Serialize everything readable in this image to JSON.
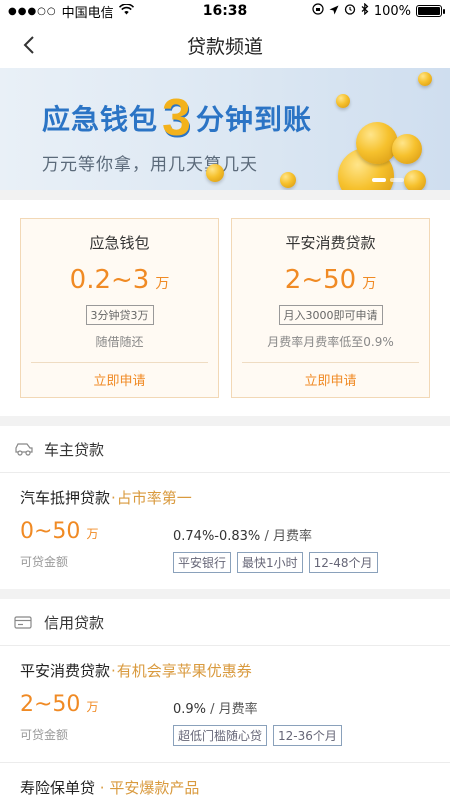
{
  "status": {
    "carrier": "中国电信",
    "time": "16:38",
    "battery": "100%"
  },
  "nav": {
    "title": "贷款频道"
  },
  "banner": {
    "headline_left": "应急钱包",
    "headline_number": "3",
    "headline_right": "分钟到账",
    "subline": "万元等你拿，用几天算几天"
  },
  "featured": [
    {
      "name": "应急钱包",
      "rate": "0.2~3",
      "unit": "万",
      "tag": "3分钟贷3万",
      "desc": "随借随还",
      "apply": "立即申请"
    },
    {
      "name": "平安消费贷款",
      "rate": "2~50",
      "unit": "万",
      "tag": "月入3000即可申请",
      "desc": "月费率月费率低至0.9%",
      "apply": "立即申请"
    }
  ],
  "car_section": {
    "title": "车主贷款",
    "items": [
      {
        "name": "汽车抵押贷款",
        "highlight": "占市率第一",
        "amount": "0~50",
        "unit": "万",
        "amount_label": "可贷金额",
        "rate": "0.74%-0.83%",
        "rate_label": "/ 月费率",
        "tags": [
          "平安银行",
          "最快1小时",
          "12-48个月"
        ]
      }
    ]
  },
  "credit_section": {
    "title": "信用贷款",
    "items": [
      {
        "name": "平安消费贷款",
        "highlight": "有机会享苹果优惠券",
        "amount": "2~50",
        "unit": "万",
        "amount_label": "可贷金额",
        "rate": "0.9%",
        "rate_label": "/ 月费率",
        "tags": [
          "超低门槛随心贷",
          "12-36个月"
        ]
      }
    ],
    "last_item": {
      "name": "寿险保单贷",
      "highlight": "平安爆款产品"
    }
  },
  "colors": {
    "accent": "#f08a24",
    "highlight": "#d99a3e",
    "banner_blue": "#2b74c5"
  }
}
